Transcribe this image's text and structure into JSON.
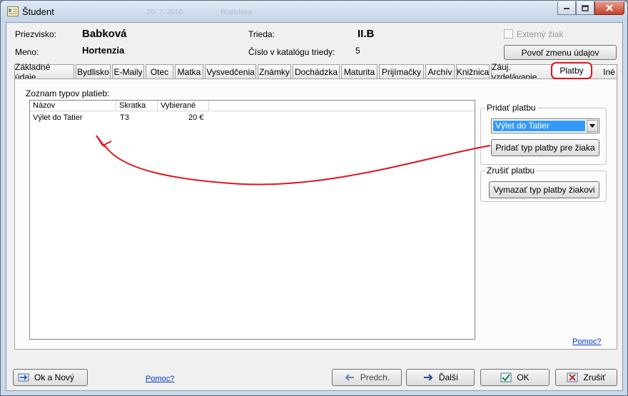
{
  "window": {
    "title": "Študent",
    "ghost_left": "20. 7. 2010",
    "ghost_right": "Bratislava"
  },
  "header": {
    "surname_label": "Priezvisko:",
    "surname": "Babková",
    "name_label": "Meno:",
    "name": "Hortenzia",
    "class_label": "Trieda:",
    "class_value": "II.B",
    "catalog_label": "Číslo v katalógu triedy:",
    "catalog_value": "5",
    "external_label": "Externý žiak",
    "allow_edit_label": "Povoľ zmenu údajov"
  },
  "tabs": [
    {
      "label": "Základné údaje"
    },
    {
      "label": "Bydlisko"
    },
    {
      "label": "E-Maily"
    },
    {
      "label": "Otec"
    },
    {
      "label": "Matka"
    },
    {
      "label": "Vysvedčenia"
    },
    {
      "label": "Známky"
    },
    {
      "label": "Dochádzka"
    },
    {
      "label": "Maturita"
    },
    {
      "label": "Prijímačky"
    },
    {
      "label": "Archív"
    },
    {
      "label": "Knižnica"
    },
    {
      "label": "Záuj. vzdelávanie"
    },
    {
      "label": "Platby"
    },
    {
      "label": "Iné"
    }
  ],
  "payments": {
    "list_title": "Zoznam typov platieb:",
    "columns": [
      "Názov",
      "Skratka",
      "Vybierané"
    ],
    "rows": [
      {
        "name": "Výlet do Tatier",
        "code": "T3",
        "amount": "20 €"
      }
    ],
    "add_group_title": "Pridať platbu",
    "add_selected": "Výlet do Tatier",
    "add_button": "Pridať typ platby pre žiaka",
    "cancel_group_title": "Zrušiť platbu",
    "remove_button": "Vymazať typ platby žiakovi",
    "help_link": "Pomoc?"
  },
  "footer": {
    "ok_new": "Ok a Nový",
    "help_link": "Pomoc?",
    "prev": "Predch.",
    "next": "Ďalší",
    "ok": "OK",
    "cancel": "Zrušiť"
  },
  "colors": {
    "annotation": "#e0141e",
    "selection": "#3399ff",
    "link": "#0033cc"
  }
}
